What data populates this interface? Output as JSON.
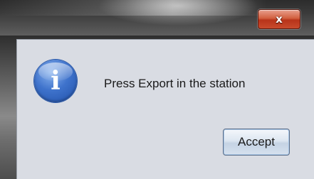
{
  "window": {
    "close_label": "x"
  },
  "dialog": {
    "icon": "info-icon",
    "icon_glyph": "i",
    "message": "Press Export in the station",
    "accept_label": "Accept"
  }
}
